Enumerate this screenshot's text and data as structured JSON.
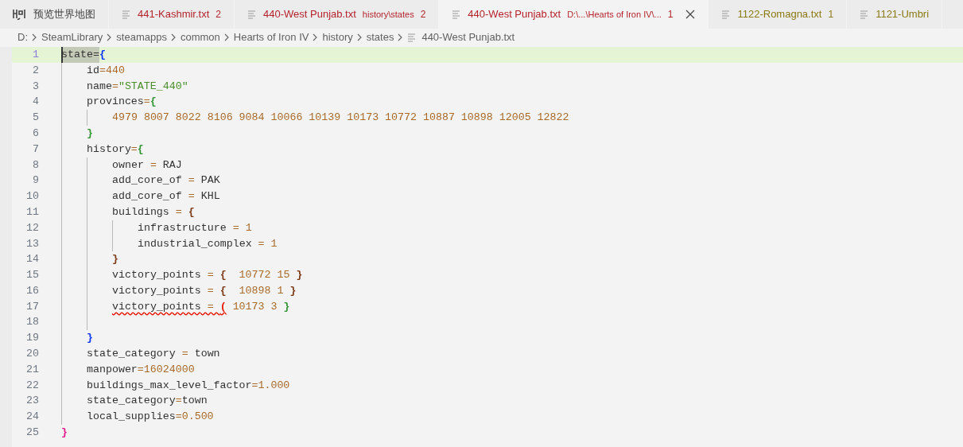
{
  "tabs": [
    {
      "label": "预览世界地图",
      "kind": "preview",
      "color": "#444444",
      "selected": false
    },
    {
      "label": "441-Kashmir.txt",
      "kind": "file",
      "color": "#b4232c",
      "count": "2",
      "selected": false
    },
    {
      "label": "440-West Punjab.txt",
      "kind": "file",
      "color": "#b4232c",
      "description": "history\\states",
      "count": "2",
      "selected": false
    },
    {
      "label": "440-West Punjab.txt",
      "kind": "file",
      "color": "#b4232c",
      "description": "D:\\...\\Hearts of Iron IV\\...",
      "count": "1",
      "selected": true
    },
    {
      "label": "1122-Romagna.txt",
      "kind": "file",
      "color": "#8a7a14",
      "count": "1",
      "selected": false
    },
    {
      "label": "1121-Umbri",
      "kind": "file",
      "color": "#8a7a14",
      "selected": false
    }
  ],
  "breadcrumb": [
    {
      "label": "D:",
      "kind": "folder"
    },
    {
      "label": "SteamLibrary",
      "kind": "folder"
    },
    {
      "label": "steamapps",
      "kind": "folder"
    },
    {
      "label": "common",
      "kind": "folder"
    },
    {
      "label": "Hearts of Iron IV",
      "kind": "folder"
    },
    {
      "label": "history",
      "kind": "folder"
    },
    {
      "label": "states",
      "kind": "folder"
    },
    {
      "label": "440-West Punjab.txt",
      "kind": "file"
    }
  ],
  "lines": [
    {
      "number": "1",
      "current": true,
      "tokens": [
        {
          "kind": "selection",
          "text": "state="
        },
        {
          "kind": "bracket",
          "text": "{",
          "color": "#0431fa"
        }
      ],
      "children": [
        {
          "number": "2",
          "current": false,
          "tokens": [
            {
              "kind": "text",
              "text": "id"
            },
            {
              "kind": "op",
              "text": "="
            },
            {
              "kind": "num",
              "text": "440"
            }
          ]
        },
        {
          "number": "3",
          "current": false,
          "tokens": [
            {
              "kind": "text",
              "text": "name"
            },
            {
              "kind": "op",
              "text": "="
            },
            {
              "kind": "str",
              "text": "\"STATE_440\""
            }
          ]
        },
        {
          "number": "4",
          "current": false,
          "tokens": [
            {
              "kind": "text",
              "text": "provinces"
            },
            {
              "kind": "op",
              "text": "="
            },
            {
              "kind": "bracket",
              "text": "{",
              "color": "#319331"
            }
          ],
          "children": [
            {
              "number": "5",
              "current": false,
              "tokens": [
                {
                  "kind": "num",
                  "text": "4979 8007 8022 8106 9084 10066 10139 10173 10772 10887 10898 12005 12822"
                }
              ]
            }
          ]
        },
        {
          "number": "6",
          "current": false,
          "tokens": [
            {
              "kind": "bracket",
              "text": "}",
              "color": "#319331"
            }
          ]
        },
        {
          "number": "7",
          "current": false,
          "tokens": [
            {
              "kind": "text",
              "text": "history"
            },
            {
              "kind": "op",
              "text": "="
            },
            {
              "kind": "bracket",
              "text": "{",
              "color": "#319331"
            }
          ],
          "children": [
            {
              "number": "8",
              "current": false,
              "tokens": [
                {
                  "kind": "text",
                  "text": "owner"
                },
                {
                  "kind": "op",
                  "text": " = "
                },
                {
                  "kind": "text",
                  "text": "RAJ"
                }
              ]
            },
            {
              "number": "9",
              "current": false,
              "tokens": [
                {
                  "kind": "text",
                  "text": "add_core_of"
                },
                {
                  "kind": "op",
                  "text": " = "
                },
                {
                  "kind": "text",
                  "text": "PAK"
                }
              ]
            },
            {
              "number": "10",
              "current": false,
              "tokens": [
                {
                  "kind": "text",
                  "text": "add_core_of"
                },
                {
                  "kind": "op",
                  "text": " = "
                },
                {
                  "kind": "text",
                  "text": "KHL"
                }
              ]
            },
            {
              "number": "11",
              "current": false,
              "tokens": [
                {
                  "kind": "text",
                  "text": "buildings"
                },
                {
                  "kind": "op",
                  "text": " = "
                },
                {
                  "kind": "bracket",
                  "text": "{",
                  "color": "#7b3814"
                }
              ],
              "children": [
                {
                  "number": "12",
                  "current": false,
                  "tokens": [
                    {
                      "kind": "text",
                      "text": "infrastructure"
                    },
                    {
                      "kind": "op",
                      "text": " = "
                    },
                    {
                      "kind": "num",
                      "text": "1"
                    }
                  ]
                },
                {
                  "number": "13",
                  "current": false,
                  "tokens": [
                    {
                      "kind": "text",
                      "text": "industrial_complex"
                    },
                    {
                      "kind": "op",
                      "text": " = "
                    },
                    {
                      "kind": "num",
                      "text": "1"
                    }
                  ]
                }
              ]
            },
            {
              "number": "14",
              "current": false,
              "tokens": [
                {
                  "kind": "bracket",
                  "text": "}",
                  "color": "#7b3814"
                }
              ]
            },
            {
              "number": "15",
              "current": false,
              "tokens": [
                {
                  "kind": "text",
                  "text": "victory_points"
                },
                {
                  "kind": "op",
                  "text": " = "
                },
                {
                  "kind": "bracket",
                  "text": "{",
                  "color": "#7b3814"
                },
                {
                  "kind": "num",
                  "text": "  10772 15 "
                },
                {
                  "kind": "bracket",
                  "text": "}",
                  "color": "#7b3814"
                }
              ]
            },
            {
              "number": "16",
              "current": false,
              "tokens": [
                {
                  "kind": "text",
                  "text": "victory_points"
                },
                {
                  "kind": "op",
                  "text": " = "
                },
                {
                  "kind": "bracket",
                  "text": "{",
                  "color": "#7b3814"
                },
                {
                  "kind": "num",
                  "text": "  10898 1 "
                },
                {
                  "kind": "bracket",
                  "text": "}",
                  "color": "#7b3814"
                }
              ]
            },
            {
              "number": "17",
              "current": false,
              "tokens": [
                {
                  "kind": "text",
                  "text": "victory_points",
                  "error": true
                },
                {
                  "kind": "op",
                  "text": " = ",
                  "error": true
                },
                {
                  "kind": "bracket",
                  "text": "(",
                  "color": "#e51400",
                  "error": true
                },
                {
                  "kind": "num",
                  "text": " 10173 3 ",
                  "error": false
                },
                {
                  "kind": "bracket",
                  "text": "}",
                  "color": "#319331",
                  "error": false
                }
              ]
            },
            {
              "number": "18",
              "current": false
            }
          ]
        },
        {
          "number": "19",
          "current": false,
          "tokens": [
            {
              "kind": "bracket",
              "text": "}",
              "color": "#0431fa"
            }
          ]
        },
        {
          "number": "20",
          "current": false,
          "tokens": [
            {
              "kind": "text",
              "text": "state_category"
            },
            {
              "kind": "op",
              "text": " = "
            },
            {
              "kind": "text",
              "text": "town"
            }
          ]
        },
        {
          "number": "21",
          "current": false,
          "tokens": [
            {
              "kind": "text",
              "text": "manpower"
            },
            {
              "kind": "op",
              "text": "="
            },
            {
              "kind": "num",
              "text": "16024000"
            }
          ]
        },
        {
          "number": "22",
          "current": false,
          "tokens": [
            {
              "kind": "text",
              "text": "buildings_max_level_factor"
            },
            {
              "kind": "op",
              "text": "="
            },
            {
              "kind": "num",
              "text": "1.000"
            }
          ]
        },
        {
          "number": "23",
          "current": false,
          "tokens": [
            {
              "kind": "text",
              "text": "state_category"
            },
            {
              "kind": "op",
              "text": "="
            },
            {
              "kind": "text",
              "text": "town"
            }
          ]
        },
        {
          "number": "24",
          "current": false,
          "tokens": [
            {
              "kind": "text",
              "text": "local_supplies"
            },
            {
              "kind": "op",
              "text": "="
            },
            {
              "kind": "num",
              "text": "0.500"
            }
          ]
        }
      ]
    },
    {
      "number": "25",
      "current": false,
      "tokens": [
        {
          "kind": "bracket",
          "text": "}",
          "color": "#e5148a"
        }
      ]
    }
  ]
}
